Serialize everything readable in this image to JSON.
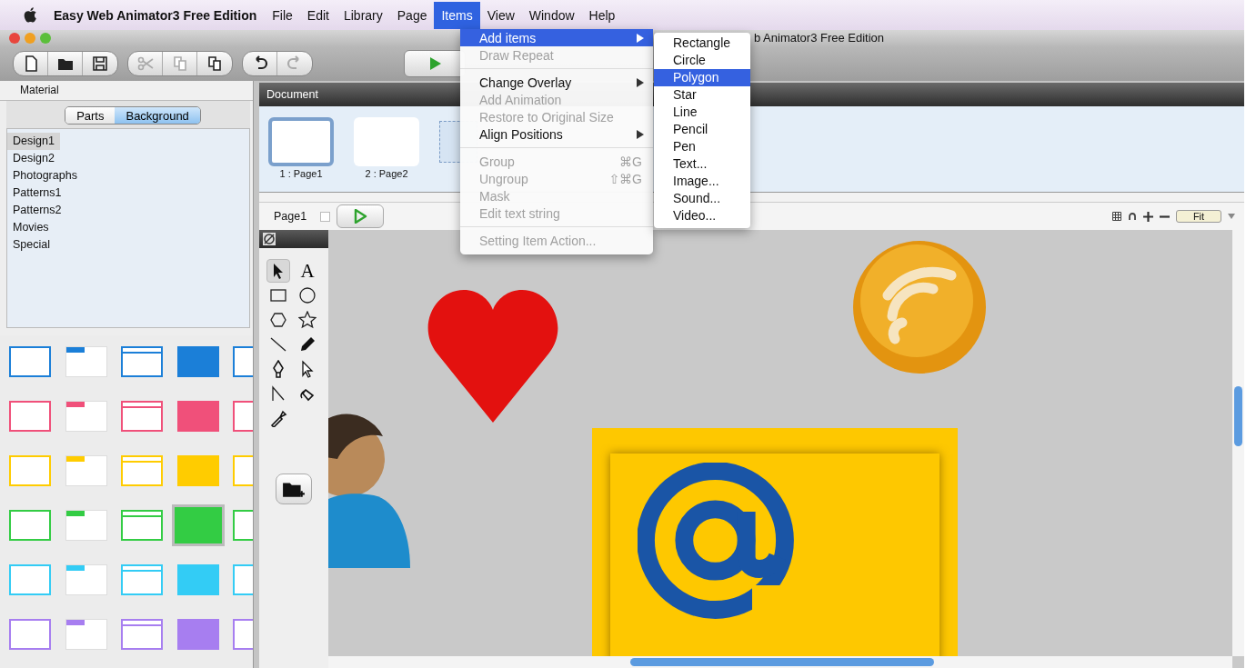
{
  "menu_bar": {
    "app_name": "Easy Web Animator3 Free Edition",
    "items": [
      {
        "label": "File",
        "selected": false
      },
      {
        "label": "Edit",
        "selected": false
      },
      {
        "label": "Library",
        "selected": false
      },
      {
        "label": "Page",
        "selected": false
      },
      {
        "label": "Items",
        "selected": true
      },
      {
        "label": "View",
        "selected": false
      },
      {
        "label": "Window",
        "selected": false
      },
      {
        "label": "Help",
        "selected": false
      }
    ]
  },
  "items_menu": [
    {
      "kind": "item",
      "label": "Add items",
      "disabled": false,
      "selected": true,
      "submenu": true
    },
    {
      "kind": "item",
      "label": "Draw Repeat",
      "disabled": true,
      "selected": false,
      "submenu": false
    },
    {
      "kind": "separator"
    },
    {
      "kind": "item",
      "label": "Change Overlay",
      "disabled": false,
      "selected": false,
      "submenu": true
    },
    {
      "kind": "item",
      "label": "Add Animation",
      "disabled": true,
      "selected": false,
      "submenu": false
    },
    {
      "kind": "item",
      "label": "Restore to Original Size",
      "disabled": true,
      "selected": false,
      "submenu": false
    },
    {
      "kind": "item",
      "label": "Align Positions",
      "disabled": false,
      "selected": false,
      "submenu": true
    },
    {
      "kind": "separator"
    },
    {
      "kind": "item",
      "label": "Group",
      "disabled": true,
      "selected": false,
      "submenu": false,
      "shortcut": "⌘G"
    },
    {
      "kind": "item",
      "label": "Ungroup",
      "disabled": true,
      "selected": false,
      "submenu": false,
      "shortcut": "⇧⌘G"
    },
    {
      "kind": "item",
      "label": "Mask",
      "disabled": true,
      "selected": false,
      "submenu": false
    },
    {
      "kind": "item",
      "label": "Edit text string",
      "disabled": true,
      "selected": false,
      "submenu": false
    },
    {
      "kind": "separator"
    },
    {
      "kind": "item",
      "label": "Setting Item Action...",
      "disabled": true,
      "selected": false,
      "submenu": false
    }
  ],
  "add_items_submenu": [
    {
      "label": "Rectangle",
      "selected": false
    },
    {
      "label": "Circle",
      "selected": false
    },
    {
      "label": "Polygon",
      "selected": true
    },
    {
      "label": "Star",
      "selected": false
    },
    {
      "label": "Line",
      "selected": false
    },
    {
      "label": "Pencil",
      "selected": false
    },
    {
      "label": "Pen",
      "selected": false
    },
    {
      "label": "Text...",
      "selected": false
    },
    {
      "label": "Image...",
      "selected": false
    },
    {
      "label": "Sound...",
      "selected": false
    },
    {
      "label": "Video...",
      "selected": false
    }
  ],
  "window": {
    "title": "b Animator3 Free Edition"
  },
  "toolbar": [
    [
      {
        "kind": "new",
        "disabled": false
      },
      {
        "kind": "open",
        "disabled": false
      },
      {
        "kind": "save",
        "disabled": false
      }
    ],
    [
      {
        "kind": "cut",
        "disabled": true
      },
      {
        "kind": "copy",
        "disabled": true
      },
      {
        "kind": "paste",
        "disabled": false
      }
    ],
    [
      {
        "kind": "undo",
        "disabled": false
      },
      {
        "kind": "redo",
        "disabled": true
      }
    ],
    [
      {
        "kind": "play",
        "disabled": false
      }
    ]
  ],
  "material": {
    "title": "Material",
    "tabs": [
      {
        "label": "Parts",
        "selected": false
      },
      {
        "label": "Background",
        "selected": true
      }
    ],
    "items": [
      {
        "label": "Design1",
        "selected": true
      },
      {
        "label": "Design2",
        "selected": false
      },
      {
        "label": "Photographs",
        "selected": false
      },
      {
        "label": "Patterns1",
        "selected": false
      },
      {
        "label": "Patterns2",
        "selected": false
      },
      {
        "label": "Movies",
        "selected": false
      },
      {
        "label": "Special",
        "selected": false
      }
    ],
    "swatch_rows": [
      {
        "color": "#1b7fd8",
        "selected": [
          false,
          false,
          false,
          false,
          false
        ]
      },
      {
        "color": "#f0507a",
        "selected": [
          false,
          false,
          false,
          false,
          false
        ]
      },
      {
        "color": "#ffcc00",
        "selected": [
          false,
          false,
          false,
          false,
          false
        ]
      },
      {
        "color": "#33cc44",
        "selected": [
          false,
          false,
          false,
          true,
          false
        ]
      },
      {
        "color": "#33ccf5",
        "selected": [
          false,
          false,
          false,
          false,
          false
        ]
      },
      {
        "color": "#a77ef0",
        "selected": [
          false,
          false,
          false,
          false,
          false
        ]
      }
    ]
  },
  "document": {
    "title": "Document",
    "pages": [
      {
        "label": "1 : Page1",
        "selected": true
      },
      {
        "label": "2 : Page2",
        "selected": false
      }
    ]
  },
  "page_bar": {
    "page_name": "Page1",
    "checked": false,
    "zoom_value": "Fit"
  },
  "tools": [
    {
      "kind": "arrow",
      "selected": true
    },
    {
      "kind": "text",
      "label": "A",
      "selected": false
    },
    {
      "kind": "rect",
      "selected": false
    },
    {
      "kind": "ellipse",
      "selected": false
    },
    {
      "kind": "hexagon",
      "selected": false
    },
    {
      "kind": "star",
      "selected": false
    },
    {
      "kind": "line",
      "selected": false
    },
    {
      "kind": "pencil",
      "selected": false
    },
    {
      "kind": "pen",
      "selected": false
    },
    {
      "kind": "subselect",
      "selected": false
    },
    {
      "kind": "polyline",
      "selected": false
    },
    {
      "kind": "bucket",
      "selected": false
    },
    {
      "kind": "eyedropper",
      "selected": false
    }
  ]
}
